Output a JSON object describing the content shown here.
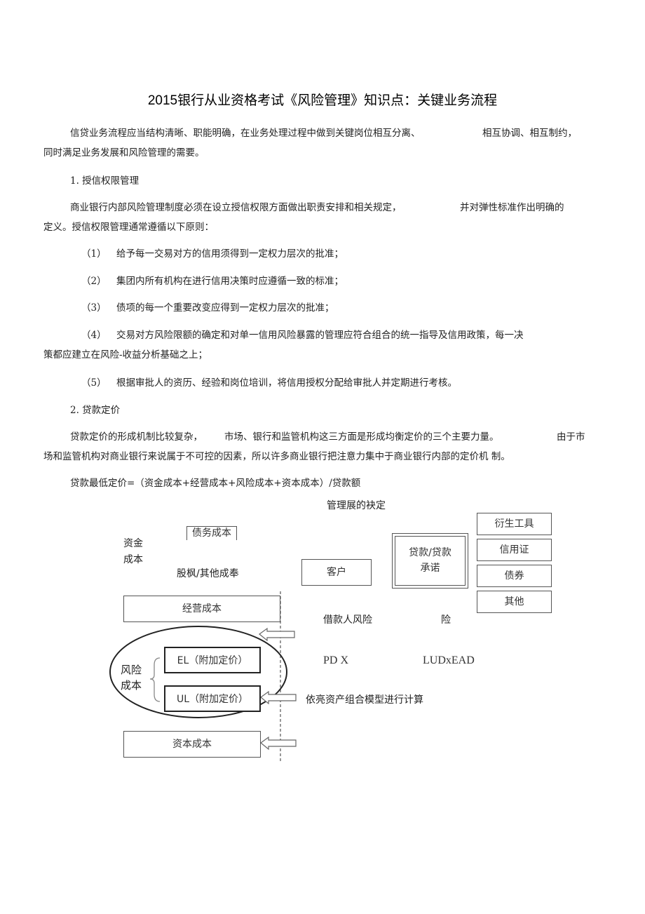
{
  "document": {
    "title": "2015银行从业资格考试《风险管理》知识点：关键业务流程",
    "intro": {
      "line1a": "信贷业务流程应当结构清晰、职能明确，在业务处理过程中做到关键岗位相互分离、",
      "line1b": "相互协调、相互制约，",
      "line2": "同时满足业务发展和风险管理的需要。"
    },
    "section1": {
      "heading": "1. 授信权限管理",
      "para_line1a": "商业银行内部风险管理制度必须在设立授信权限方面做出职责安排和相关规定，",
      "para_line1b": "并对弹性标准作出明确的",
      "para_line2": "定义。授信权限管理通常遵循以下原则：",
      "items": [
        {
          "num": "（1）",
          "text": "给予每一交易对方的信用须得到一定权力层次的批准；"
        },
        {
          "num": "（2）",
          "text": "集团内所有机构在进行信用决策时应遵循一致的标准；"
        },
        {
          "num": "（3）",
          "text": "债项的每一个重要改变应得到一定权力层次的批准；"
        },
        {
          "num": "（4）",
          "text": "交易对方风险限额的确定和对单一信用风险暴露的管理应符合组合的统一指导及信用政策，每一决",
          "continuation": "策都应建立在风险-收益分析基础之上；"
        },
        {
          "num": "（5）",
          "text": "根据审批人的资历、经验和岗位培训，将信用授权分配给审批人并定期进行考核。"
        }
      ]
    },
    "section2": {
      "heading": "2. 贷款定价",
      "para_line1a": "贷款定价的形成机制比较复杂，",
      "para_line1b": "市场、银行和监管机构这三方面是形成均衡定价的三个主要力量。",
      "para_line1c": "由于市",
      "para_line2": "场和监管机构对商业银行来说属于不可控的因素，所以许多商业银行把注意力集中于商业银行内部的定价机 制。",
      "formula": "贷款最低定价=（资金成本+经营成本+风险成本+资本成本）/贷款额"
    },
    "diagram": {
      "top_label": "管理展的袂定",
      "debt_cost": "债务成本",
      "fund_cost_line1": "资金",
      "fund_cost_line2": "成本",
      "equity_cost": "股枫/其他成奉",
      "operating_cost": "经营成本",
      "risk_cost_line1": "风险",
      "risk_cost_line2": "成本",
      "el_box": "EL（附加定价）",
      "ul_box": "UL（附加定价）",
      "capital_cost": "资本成本",
      "customer": "客户",
      "loan_commit_line1": "贷款/贷款",
      "loan_commit_line2": "承诺",
      "products": [
        "衍生工具",
        "信用证",
        "债券",
        "其他"
      ],
      "borrower_risk": "借款人风险",
      "risk_fragment": "险",
      "pd_label": "PD X",
      "lgd_label": "LUDxEAD",
      "portfolio_note": "依亮资产组合模型进行计算"
    }
  }
}
